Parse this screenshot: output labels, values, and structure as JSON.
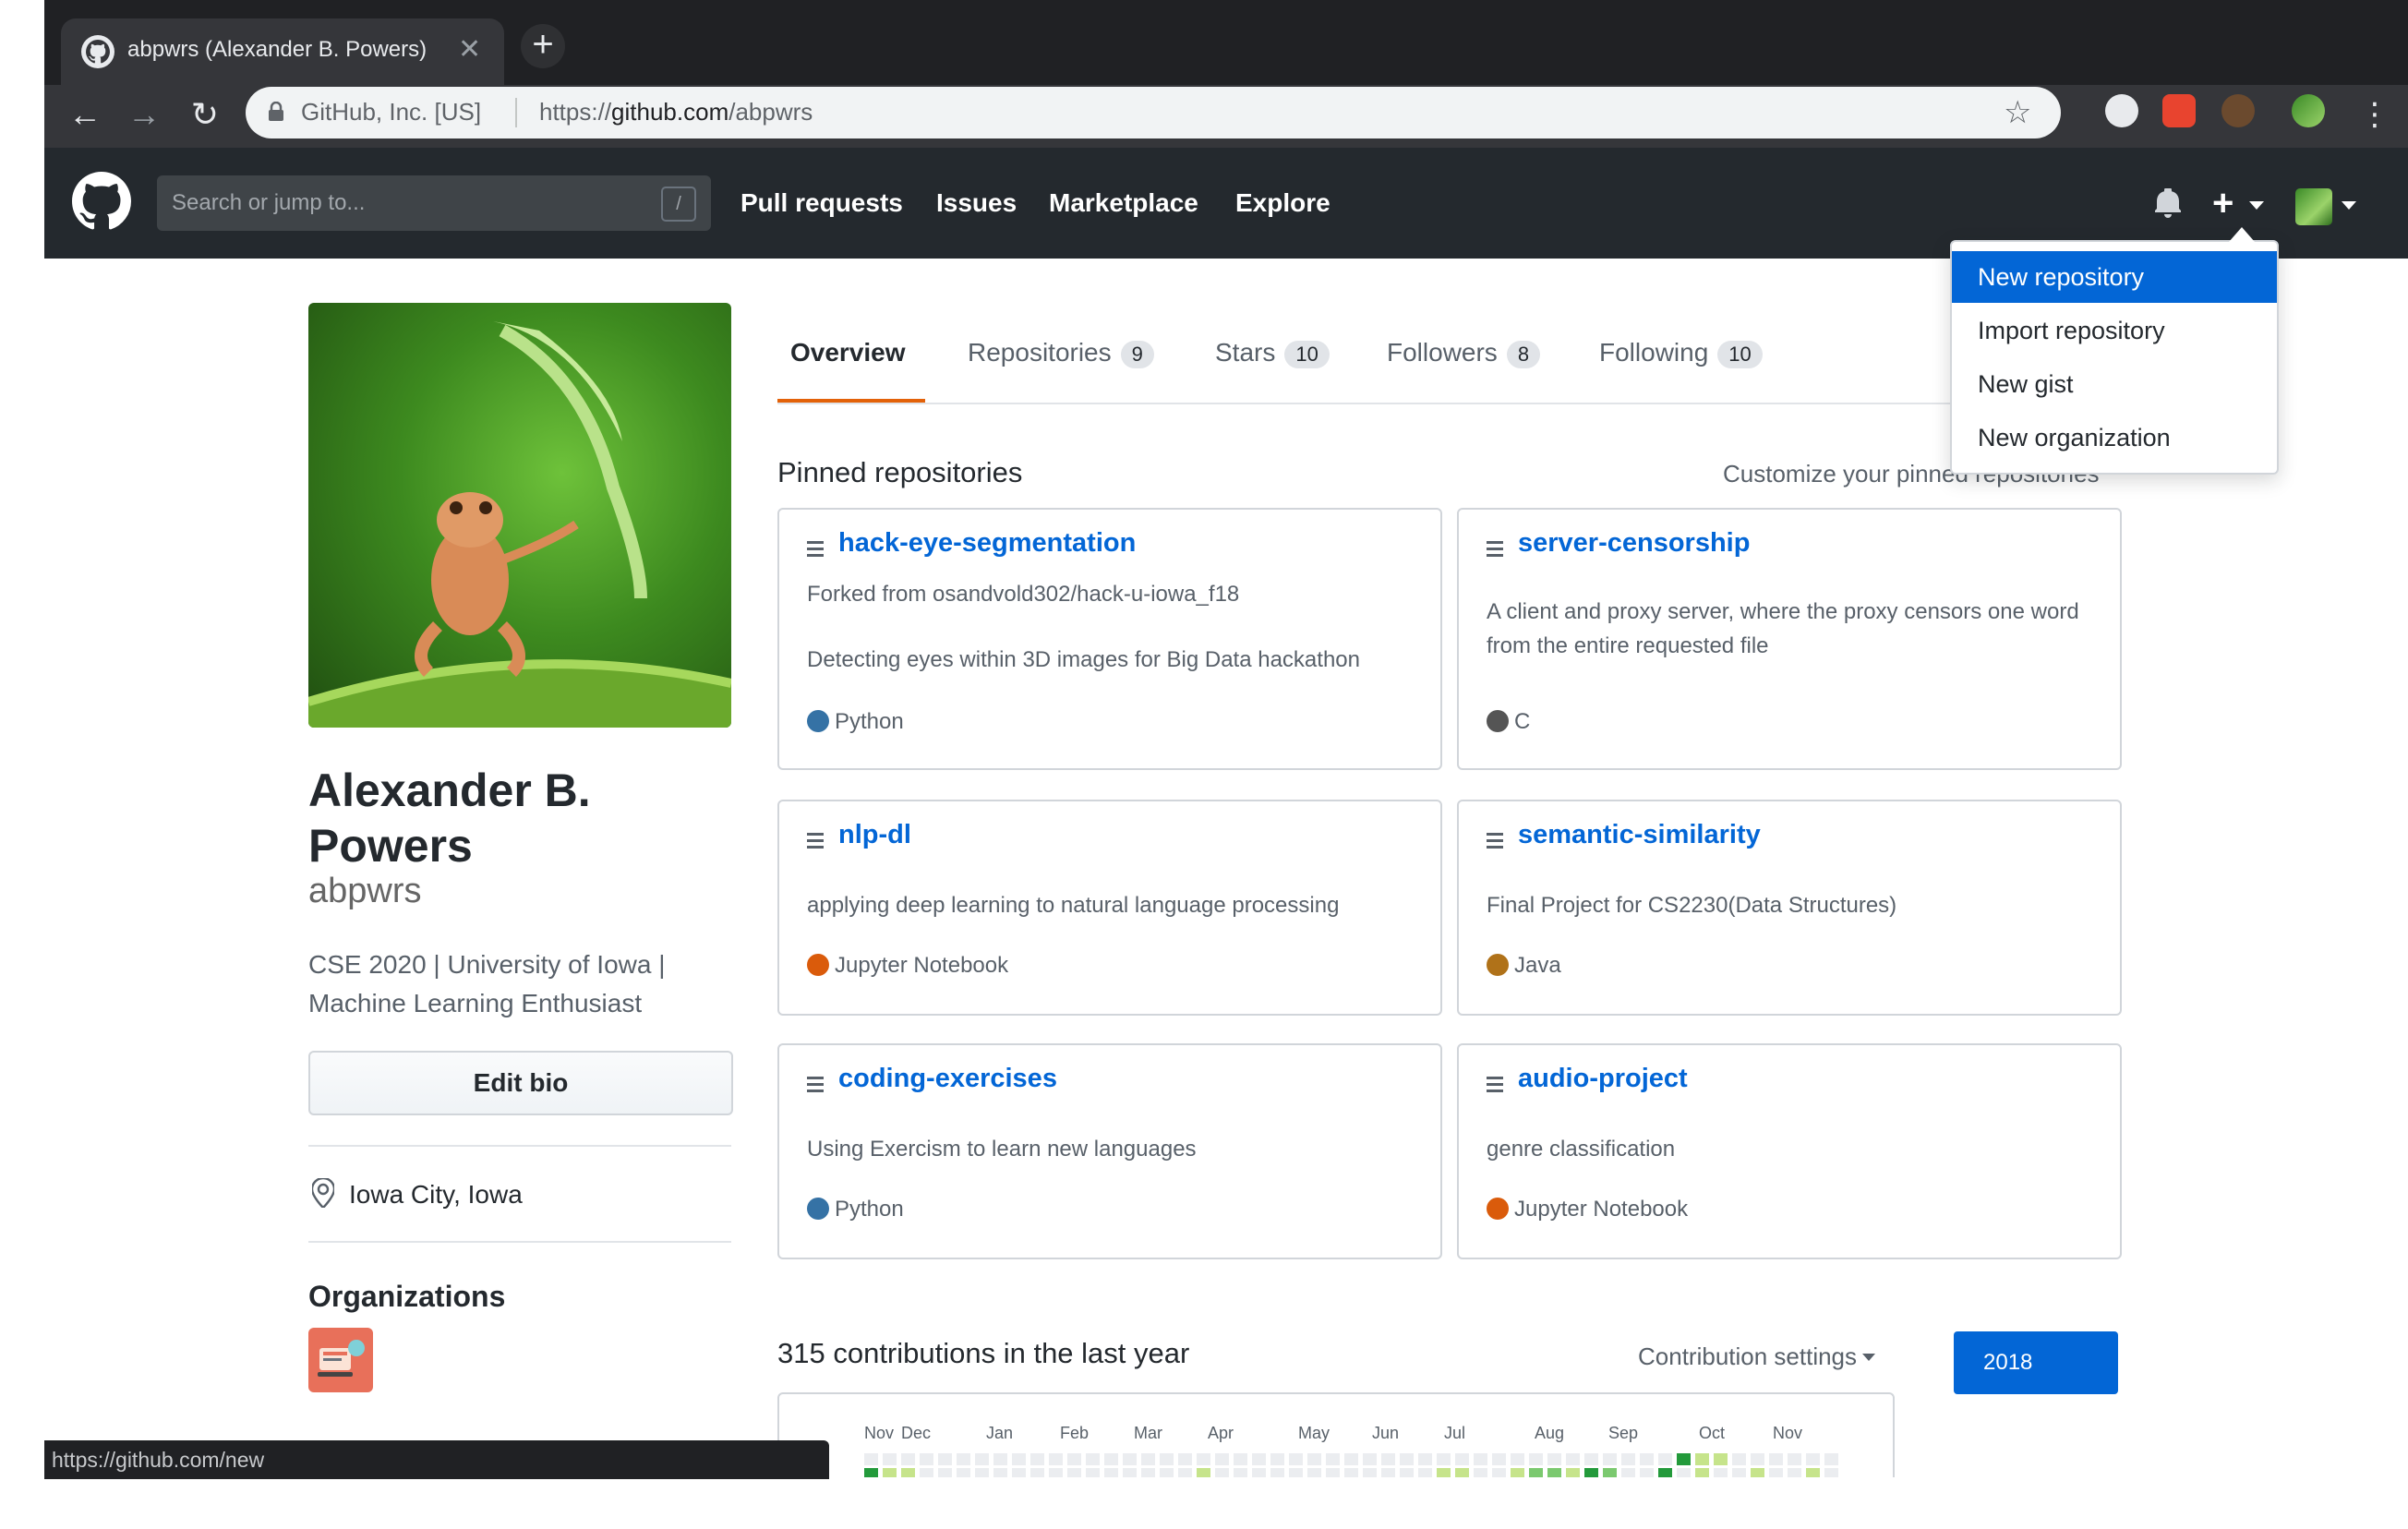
{
  "browser": {
    "tab_title": "abpwrs (Alexander B. Powers)",
    "site_identity": "GitHub, Inc. [US]",
    "url_prefix": "https://",
    "url_host": "github.com",
    "url_path": "/abpwrs",
    "status_url": "https://github.com/new"
  },
  "header": {
    "search_placeholder": "Search or jump to...",
    "search_shortcut": "/",
    "nav": [
      "Pull requests",
      "Issues",
      "Marketplace",
      "Explore"
    ]
  },
  "new_menu": {
    "items": [
      "New repository",
      "Import repository",
      "New gist",
      "New organization"
    ],
    "active_index": 0
  },
  "profile": {
    "name_line1": "Alexander B.",
    "name_line2": "Powers",
    "login": "abpwrs",
    "bio_line1": "CSE 2020 | University of Iowa |",
    "bio_line2": "Machine Learning Enthusiast",
    "edit_bio_label": "Edit bio",
    "location": "Iowa City, Iowa",
    "organizations_heading": "Organizations"
  },
  "tabs": [
    {
      "label": "Overview",
      "count": ""
    },
    {
      "label": "Repositories",
      "count": "9"
    },
    {
      "label": "Stars",
      "count": "10"
    },
    {
      "label": "Followers",
      "count": "8"
    },
    {
      "label": "Following",
      "count": "10"
    }
  ],
  "pinned": {
    "heading": "Pinned repositories",
    "customize_link": "Customize your pinned repositories",
    "repos": [
      {
        "name": "hack-eye-segmentation",
        "fork": "Forked from osandvold302/hack-u-iowa_f18",
        "desc": "Detecting eyes within 3D images for Big Data hackathon",
        "lang": "Python",
        "lang_color": "#3572A5"
      },
      {
        "name": "server-censorship",
        "fork": "",
        "desc": "A client and proxy server, where the proxy censors one word from the entire requested file",
        "lang": "C",
        "lang_color": "#555555"
      },
      {
        "name": "nlp-dl",
        "fork": "",
        "desc": "applying deep learning to natural language processing",
        "lang": "Jupyter Notebook",
        "lang_color": "#DA5B0B"
      },
      {
        "name": "semantic-similarity",
        "fork": "",
        "desc": "Final Project for CS2230(Data Structures)",
        "lang": "Java",
        "lang_color": "#b07219"
      },
      {
        "name": "coding-exercises",
        "fork": "",
        "desc": "Using Exercism to learn new languages",
        "lang": "Python",
        "lang_color": "#3572A5"
      },
      {
        "name": "audio-project",
        "fork": "",
        "desc": "genre classification",
        "lang": "Jupyter Notebook",
        "lang_color": "#DA5B0B"
      }
    ]
  },
  "contributions": {
    "heading": "315 contributions in the last year",
    "settings_label": "Contribution settings",
    "year_label": "2018",
    "months": [
      "Nov",
      "Dec",
      "Jan",
      "Feb",
      "Mar",
      "Apr",
      "May",
      "Jun",
      "Jul",
      "Aug",
      "Sep",
      "Oct",
      "Nov"
    ]
  }
}
